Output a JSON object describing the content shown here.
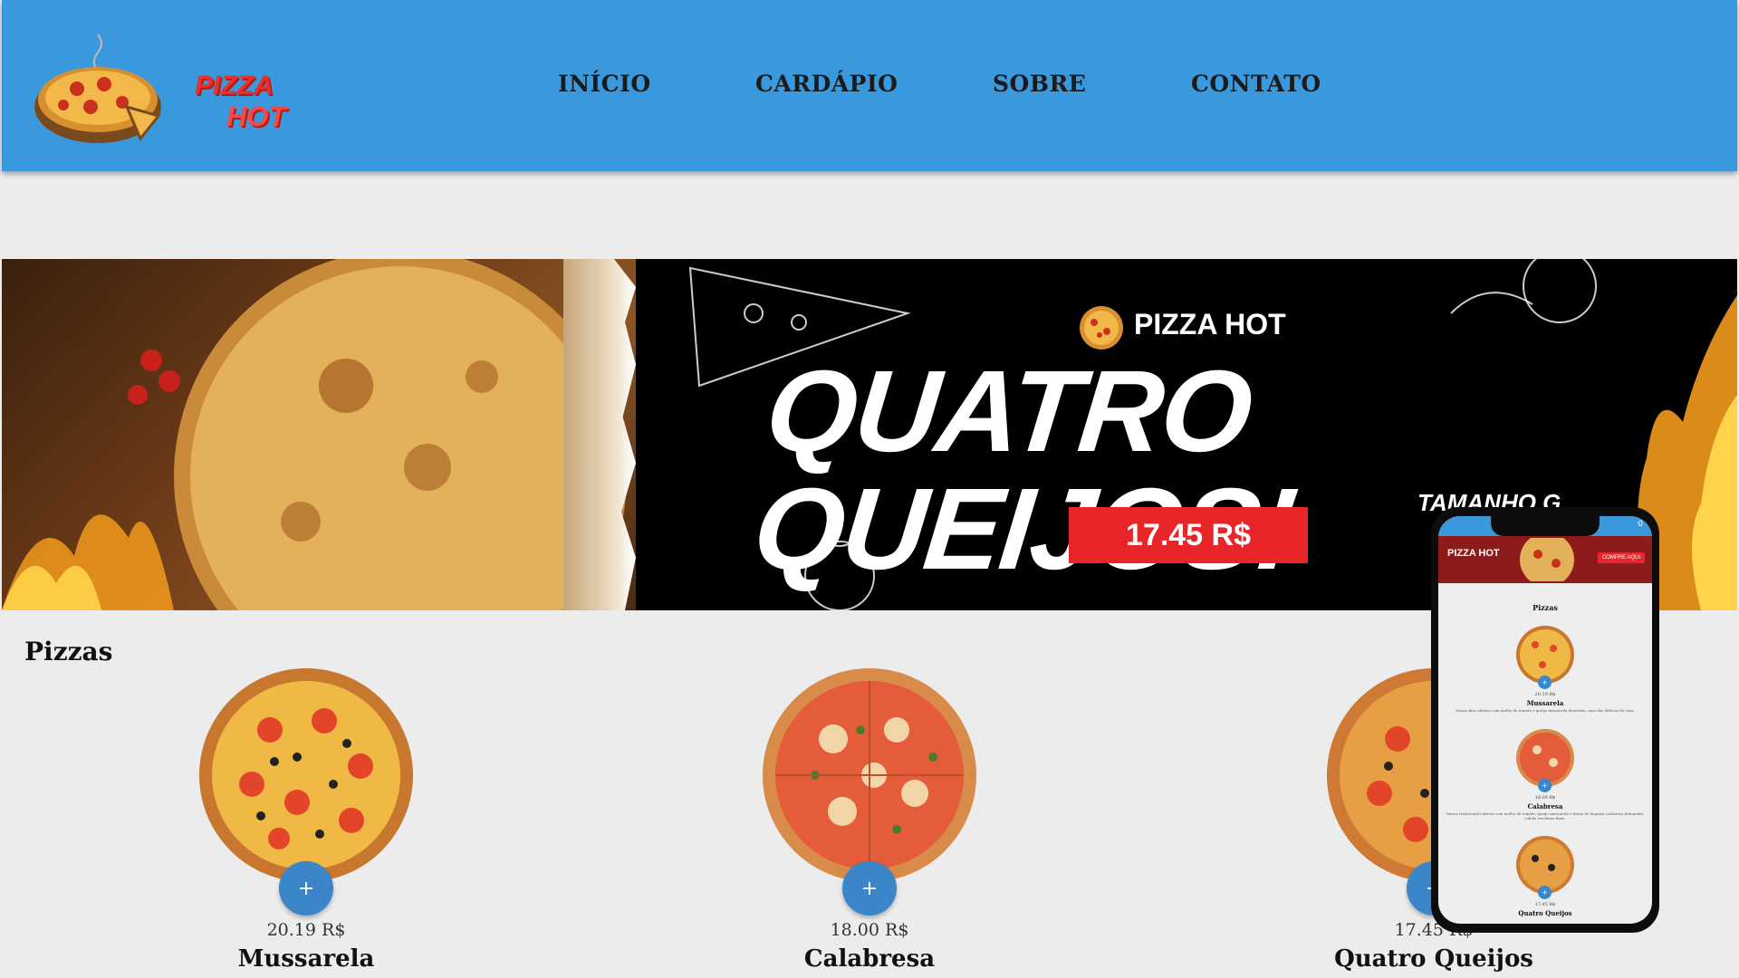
{
  "header": {
    "logo": {
      "line1": "PIZZA",
      "line2": "HOT"
    },
    "nav": [
      "INÍCIO",
      "CARDÁPIO",
      "SOBRE",
      "CONTATO"
    ]
  },
  "banner": {
    "brand": "PIZZA HOT",
    "headline": "QUATRO QUEIJOS!",
    "price": "17.45 R$",
    "size_text": "TAMANHO G"
  },
  "section": {
    "title": "Pizzas"
  },
  "products": [
    {
      "name": "Mussarela",
      "price": "20.19 R$",
      "add_label": "+"
    },
    {
      "name": "Calabresa",
      "price": "18.00 R$",
      "add_label": "+"
    },
    {
      "name": "Quatro Queijos",
      "price": "17.45 R$",
      "add_label": "+"
    }
  ],
  "phone": {
    "status": "0",
    "brand": "PIZZA HOT",
    "cta": "COMPRE AQUI",
    "heading": "Pizzas",
    "items": [
      {
        "name": "Mussarela",
        "price": "20.19 R$",
        "desc": "Massa fina coberta com molho de tomate e queijo mussarela derretido, uma das delícias da casa."
      },
      {
        "name": "Calabresa",
        "price": "18.00 R$",
        "desc": "Massa tradicional coberta com molho de tomate, queijo mussarela e fatias de linguiça calabresa defumada, cebola em fatias finas."
      },
      {
        "name": "Quatro Queijos",
        "price": "17.45 R$",
        "desc": ""
      }
    ]
  },
  "colors": {
    "header": "#3a98dd",
    "accent": "#e8262a",
    "button": "#3a86c8"
  }
}
